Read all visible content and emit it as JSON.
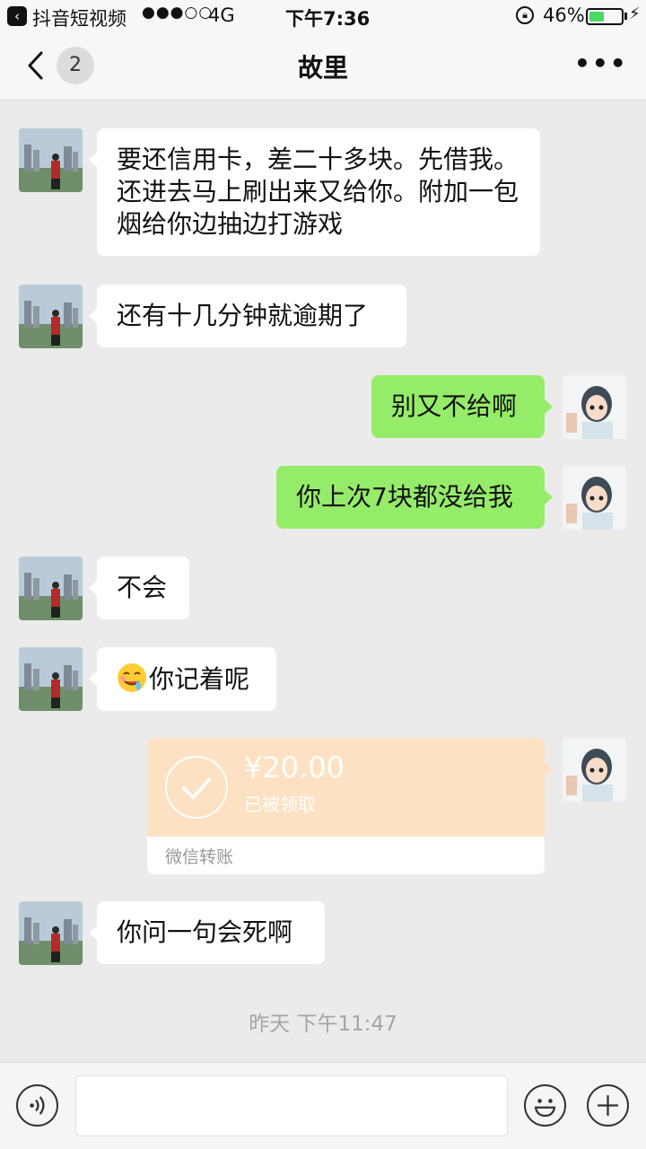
{
  "status_bar": {
    "app_name": "抖音短视频",
    "signal": "●●●○○",
    "network": "4G",
    "time": "下午7:36",
    "battery_percent": "46%",
    "battery_level": 0.46
  },
  "nav": {
    "unread_count": "2",
    "title": "故里",
    "more": "•••"
  },
  "messages": [
    {
      "from": "them",
      "text": "要还信用卡，差二十多块。先借我。还进去马上刷出来又给你。附加一包烟给你边抽边打游戏"
    },
    {
      "from": "them",
      "text": "还有十几分钟就逾期了"
    },
    {
      "from": "me",
      "text": "别又不给啊"
    },
    {
      "from": "me",
      "text": "你上次7块都没给我"
    },
    {
      "from": "them",
      "text": "不会"
    },
    {
      "from": "them",
      "text": "你记着呢",
      "emoji": "drooling-face-icon"
    },
    {
      "from": "me",
      "type": "transfer",
      "amount": "¥20.00",
      "status": "已被领取",
      "label": "微信转账"
    },
    {
      "from": "them",
      "text": "你问一句会死啊"
    }
  ],
  "timestamp": "昨天  下午11:47",
  "input_bar": {
    "value": "",
    "icons": [
      "voice-icon",
      "emoji-icon",
      "plus-icon"
    ]
  },
  "colors": {
    "out_bubble": "#95ec69",
    "in_bubble": "#ffffff",
    "transfer": "#fde1c3",
    "background": "#ebebeb"
  }
}
